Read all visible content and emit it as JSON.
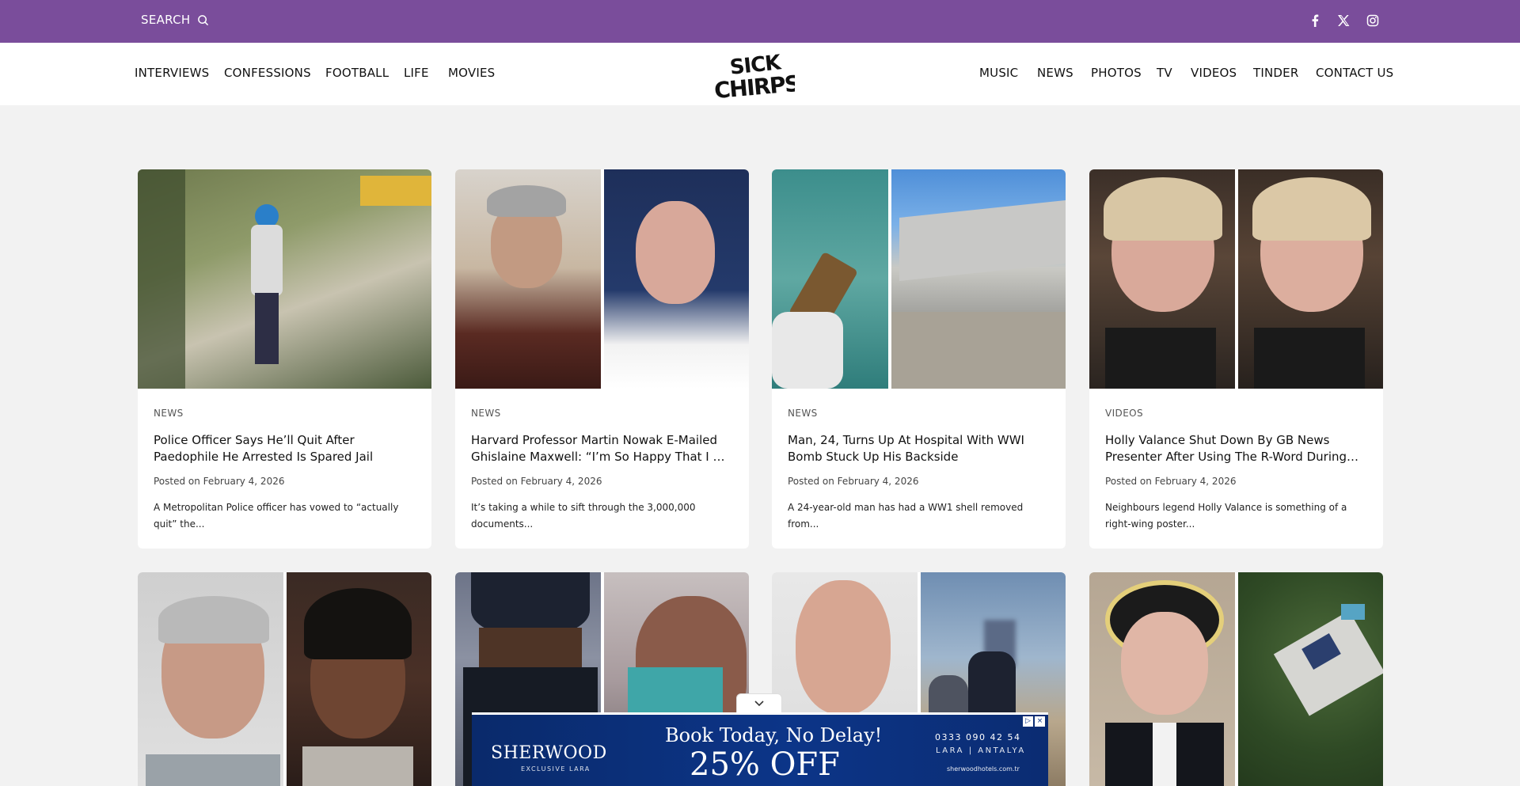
{
  "topbar": {
    "search_label": "SEARCH",
    "social": [
      {
        "icon": "facebook-icon"
      },
      {
        "icon": "x-twitter-icon"
      },
      {
        "icon": "instagram-icon"
      }
    ]
  },
  "logo": {
    "text": "SICK CHIRPSE"
  },
  "nav": {
    "left": [
      "INTERVIEWS",
      "CONFESSIONS",
      "FOOTBALL",
      "LIFE",
      "MOVIES"
    ],
    "right": [
      "MUSIC",
      "NEWS",
      "PHOTOS",
      "TV",
      "VIDEOS",
      "TINDER",
      "CONTACT US"
    ]
  },
  "cards": [
    {
      "category": "NEWS",
      "title": "Police Officer Says He’ll Quit After Paedophile He Arrested Is Spared Jail",
      "date": "Posted on February 4, 2026",
      "excerpt": "A Metropolitan Police officer has vowed to “actually quit” the..."
    },
    {
      "category": "NEWS",
      "title": "Harvard Professor Martin Nowak E-Mailed Ghislaine Maxwell: “I’m So Happy That I Did No...",
      "date": "Posted on February 4, 2026",
      "excerpt": "It’s taking a while to sift through the 3,000,000 documents..."
    },
    {
      "category": "NEWS",
      "title": "Man, 24, Turns Up At Hospital With WWI Bomb Stuck Up His Backside",
      "date": "Posted on February 4, 2026",
      "excerpt": "A 24-year-old man has had a WW1 shell removed from..."
    },
    {
      "category": "VIDEOS",
      "title": "Holly Valance Shut Down By GB News Presenter After Using The R-Word During Interview",
      "date": "Posted on February 4, 2026",
      "excerpt": "Neighbours legend Holly Valance is something of a right-wing poster..."
    }
  ],
  "ad": {
    "brand": "SHERWOOD",
    "brand_sub": "EXCLUSIVE LARA",
    "headline": "Book Today, No Delay!",
    "offer": "25% OFF",
    "phone": "0333 090 42 54",
    "location": "LARA | ANTALYA",
    "site": "sherwoodhotels.com.tr"
  },
  "colors": {
    "topbar": "#7a4d9b",
    "ad_bg": "#0c3588"
  }
}
